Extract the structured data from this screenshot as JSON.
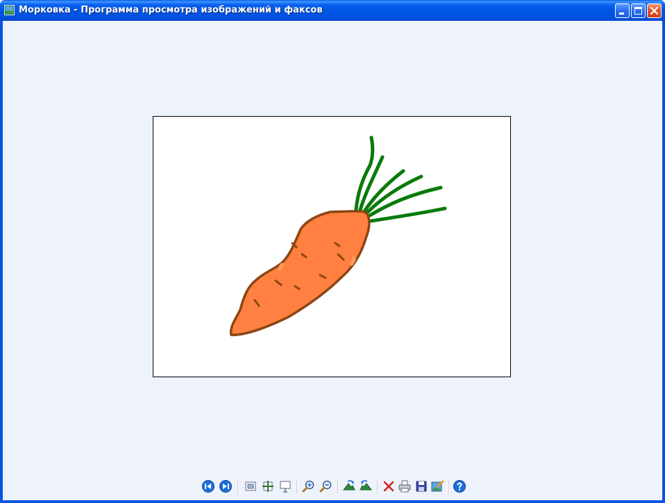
{
  "window": {
    "title": "Морковка - Программа просмотра изображений и факсов"
  },
  "image": {
    "subject": "carrot drawing",
    "colors": {
      "carrot_fill": "#ff8040",
      "carrot_outline": "#8b4513",
      "leaves": "#0a7a0a"
    }
  },
  "toolbar": {
    "buttons": [
      {
        "icon": "previous-image-icon"
      },
      {
        "icon": "next-image-icon"
      },
      {
        "icon": "best-fit-icon"
      },
      {
        "icon": "actual-size-icon"
      },
      {
        "icon": "slideshow-icon"
      },
      {
        "icon": "zoom-in-icon"
      },
      {
        "icon": "zoom-out-icon"
      },
      {
        "icon": "rotate-clockwise-icon"
      },
      {
        "icon": "rotate-counterclockwise-icon"
      },
      {
        "icon": "delete-icon"
      },
      {
        "icon": "print-icon"
      },
      {
        "icon": "save-icon"
      },
      {
        "icon": "edit-icon"
      },
      {
        "icon": "help-icon"
      }
    ]
  },
  "colors": {
    "titlebar": "#0055e5",
    "client_background": "#eef2fa",
    "close_button": "#e0562a"
  }
}
